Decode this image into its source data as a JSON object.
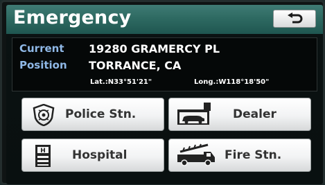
{
  "header": {
    "title": "Emergency",
    "back_icon": "return-arrow-icon"
  },
  "position": {
    "label_line1": "Current",
    "label_line2": "Position",
    "street": "19280 GRAMERCY PL",
    "city": "TORRANCE, CA",
    "latitude": "Lat.:N33°51'21\"",
    "longitude": "Long.:W118°18'50\""
  },
  "buttons": [
    {
      "label": "Police Stn.",
      "icon": "police-badge-icon"
    },
    {
      "label": "Dealer",
      "icon": "dealer-garage-icon"
    },
    {
      "label": "Hospital",
      "icon": "hospital-icon"
    },
    {
      "label": "Fire Stn.",
      "icon": "fire-truck-icon"
    }
  ],
  "colors": {
    "header": "#2e6a62",
    "label_blue": "#8fb8e6",
    "button_text": "#333333"
  }
}
